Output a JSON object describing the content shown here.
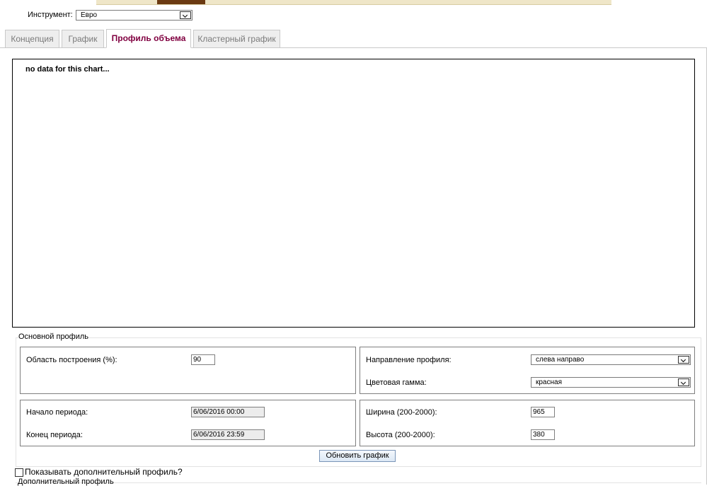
{
  "instrument": {
    "label": "Инструмент:",
    "value": "Евро"
  },
  "tabs": [
    {
      "label": "Концепция",
      "active": false
    },
    {
      "label": "График",
      "active": false
    },
    {
      "label": "Профиль объема",
      "active": true
    },
    {
      "label": "Кластерный график",
      "active": false
    }
  ],
  "chart": {
    "message": "no data for this chart..."
  },
  "main_profile": {
    "legend": "Основной профиль",
    "area_label": "Область построения (%):",
    "area_value": "90",
    "direction_label": "Направление профиля:",
    "direction_value": "слева направо",
    "color_label": "Цветовая гамма:",
    "color_value": "красная",
    "start_label": "Начало периода:",
    "start_value": "6/06/2016 00:00",
    "end_label": "Конец периода:",
    "end_value": "6/06/2016 23:59",
    "width_label": "Ширина (200-2000):",
    "width_value": "965",
    "height_label": "Высота (200-2000):",
    "height_value": "380"
  },
  "update_button": "Обновить график",
  "extra_profile": {
    "checkbox_label": "Показывать дополнительный профиль?",
    "legend": "Дополнительный профиль"
  },
  "colors": {
    "active_tab": "#800040",
    "tab_border": "#c9c9c9"
  }
}
